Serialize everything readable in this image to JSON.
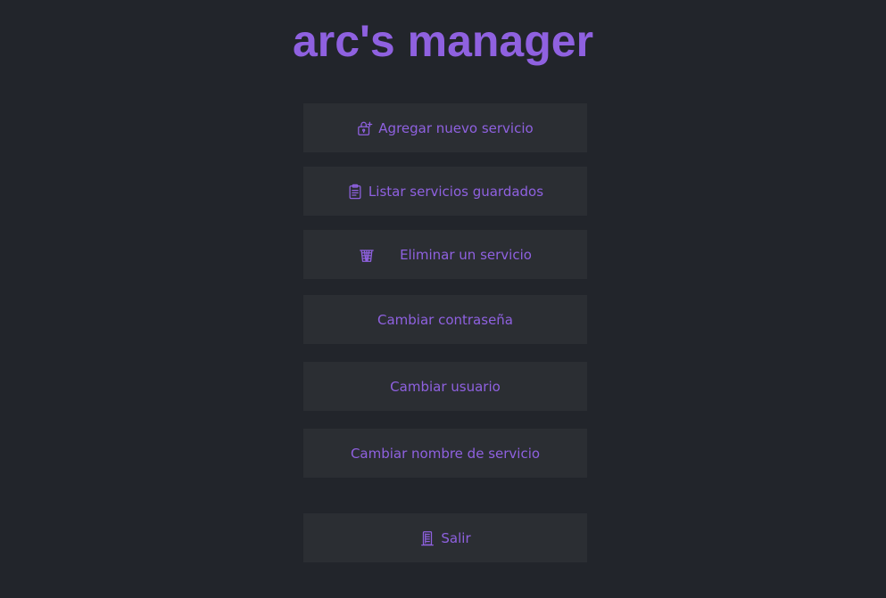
{
  "app": {
    "title": "arc's manager",
    "accent_color": "#8f61e0",
    "background_color": "#22252b",
    "button_color": "#2b2e33"
  },
  "menu": {
    "items": [
      {
        "label": "Agregar nuevo servicio",
        "icon": "add-service-icon"
      },
      {
        "label": "Listar servicios guardados",
        "icon": "clipboard-list-icon"
      },
      {
        "label": "Eliminar un servicio",
        "icon": "trash-basket-icon"
      },
      {
        "label": "Cambiar contraseña",
        "icon": ""
      },
      {
        "label": "Cambiar usuario",
        "icon": ""
      },
      {
        "label": "Cambiar nombre de servicio",
        "icon": ""
      }
    ],
    "exit": {
      "label": "Salir",
      "icon": "exit-door-icon"
    }
  }
}
